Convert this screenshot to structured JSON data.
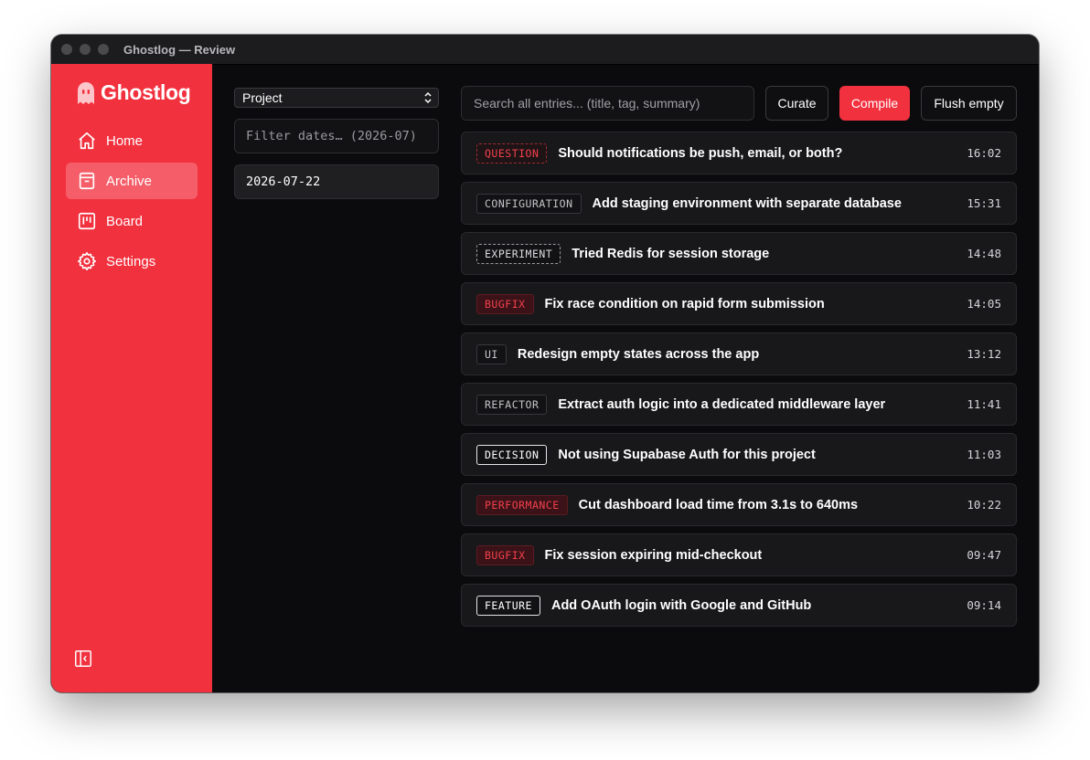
{
  "window": {
    "title": "Ghostlog — Review"
  },
  "app": {
    "name": "Ghostlog",
    "brand_color": "#f2313f"
  },
  "sidebar": {
    "items": [
      {
        "label": "Home",
        "icon": "home-icon",
        "active": false
      },
      {
        "label": "Archive",
        "icon": "archive-icon",
        "active": true
      },
      {
        "label": "Board",
        "icon": "board-icon",
        "active": false
      },
      {
        "label": "Settings",
        "icon": "gear-icon",
        "active": false
      }
    ],
    "collapse_icon": "sidebar-collapse-icon"
  },
  "filters": {
    "project_select": "Project",
    "date_filter_placeholder": "Filter dates… (2026-07)",
    "dates": [
      "2026-07-22"
    ]
  },
  "toolbar": {
    "search_placeholder": "Search all entries... (title, tag, summary)",
    "curate_label": "Curate",
    "compile_label": "Compile",
    "flush_label": "Flush empty"
  },
  "entries": [
    {
      "tag": "QUESTION",
      "style": "red-dashed",
      "title": "Should notifications be push, email, or both?",
      "time": "16:02"
    },
    {
      "tag": "CONFIGURATION",
      "style": "plain",
      "title": "Add staging environment with separate database",
      "time": "15:31"
    },
    {
      "tag": "EXPERIMENT",
      "style": "dashed",
      "title": "Tried Redis for session storage",
      "time": "14:48"
    },
    {
      "tag": "BUGFIX",
      "style": "red-fill",
      "title": "Fix race condition on rapid form submission",
      "time": "14:05"
    },
    {
      "tag": "UI",
      "style": "plain",
      "title": "Redesign empty states across the app",
      "time": "13:12"
    },
    {
      "tag": "REFACTOR",
      "style": "plain",
      "title": "Extract auth logic into a dedicated middleware layer",
      "time": "11:41"
    },
    {
      "tag": "DECISION",
      "style": "white",
      "title": "Not using Supabase Auth for this project",
      "time": "11:03"
    },
    {
      "tag": "PERFORMANCE",
      "style": "red-fill",
      "title": "Cut dashboard load time from 3.1s to 640ms",
      "time": "10:22"
    },
    {
      "tag": "BUGFIX",
      "style": "red-fill",
      "title": "Fix session expiring mid-checkout",
      "time": "09:47"
    },
    {
      "tag": "FEATURE",
      "style": "white",
      "title": "Add OAuth login with Google and GitHub",
      "time": "09:14"
    }
  ]
}
